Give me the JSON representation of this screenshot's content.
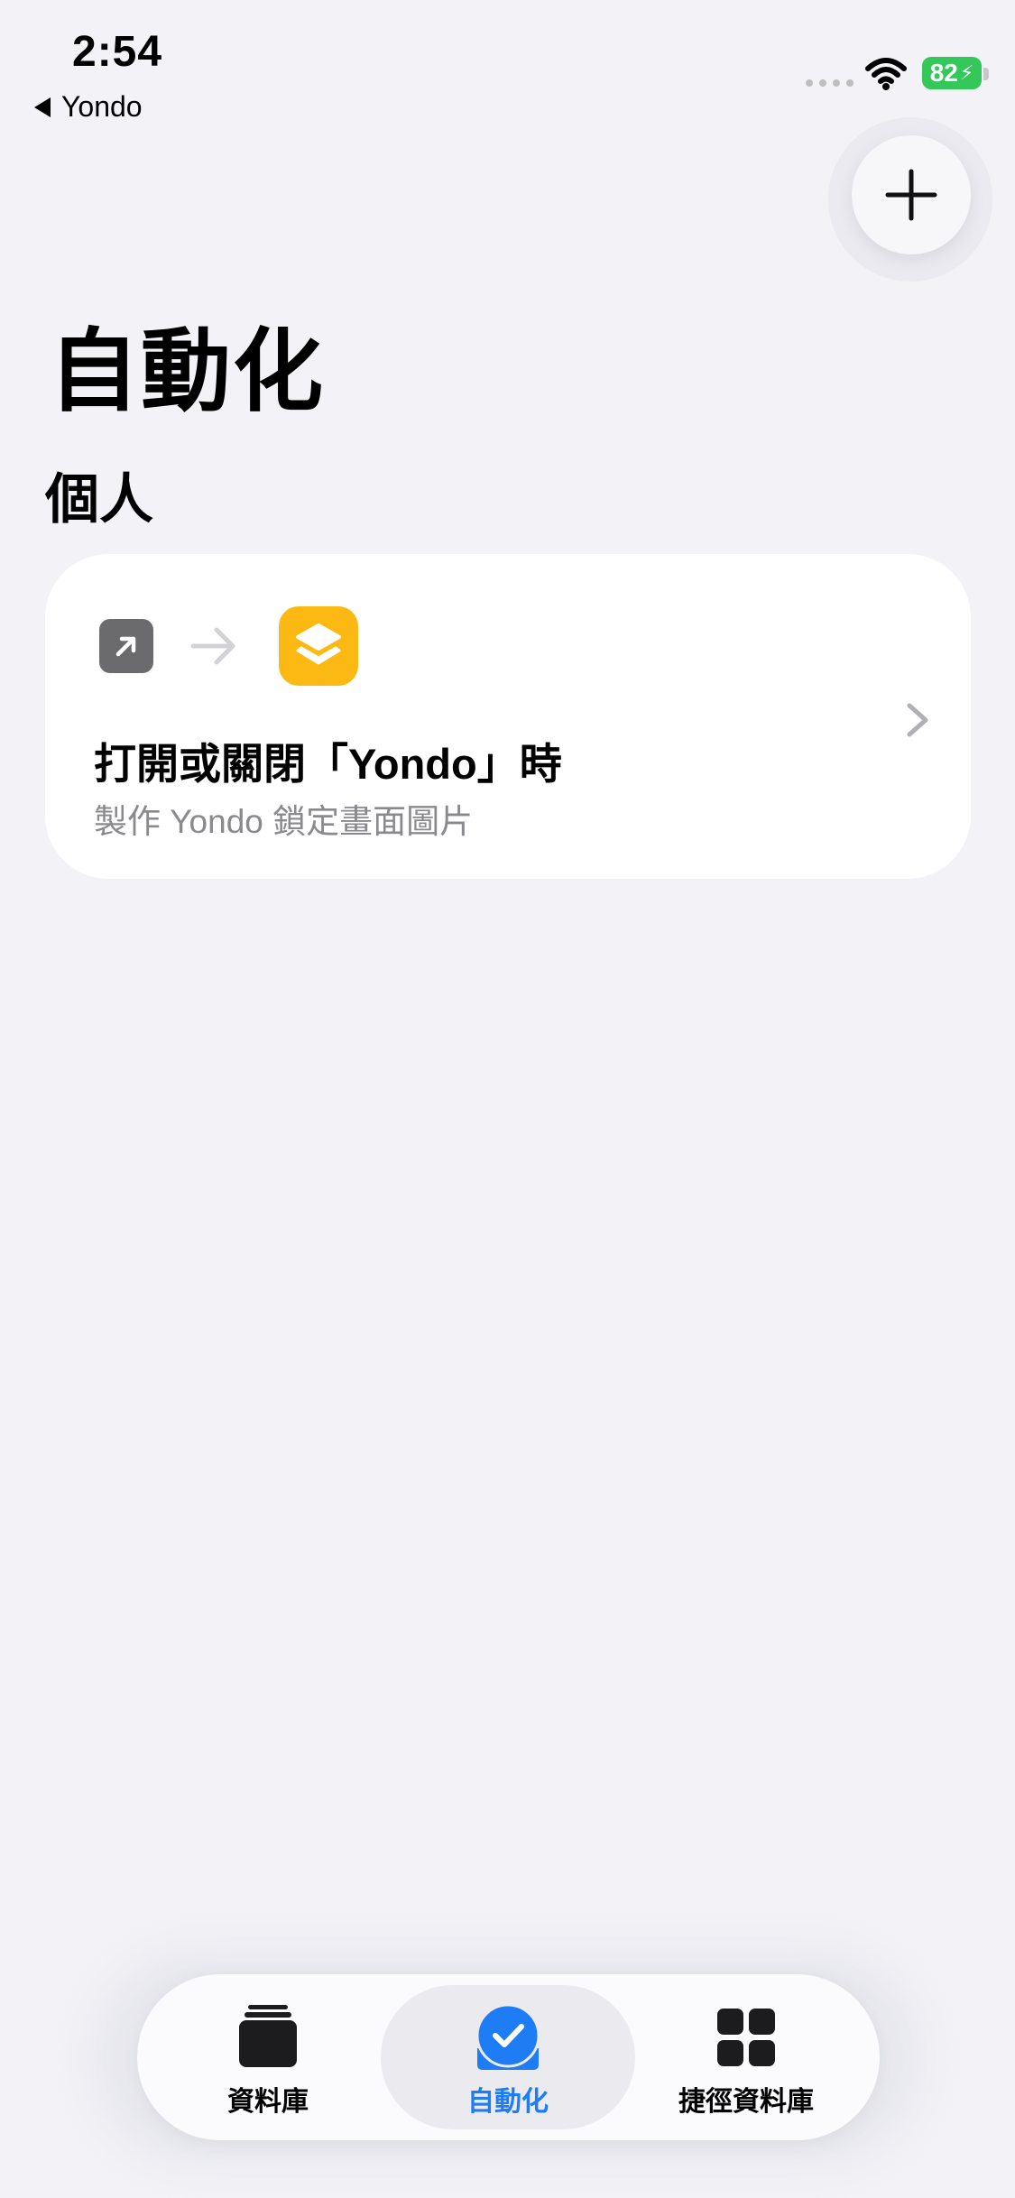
{
  "status_bar": {
    "time": "2:54",
    "back_app": "Yondo",
    "battery": "82"
  },
  "toolbar": {
    "add_icon": "plus-icon"
  },
  "page": {
    "title": "自動化",
    "section_header": "個人"
  },
  "automation_card": {
    "trigger_icon": "app-open-arrow-icon",
    "flow_icon": "right-arrow-icon",
    "app_icon": "yondo-layers-icon",
    "title": "打開或關閉「Yondo」時",
    "subtitle": "製作 Yondo 鎖定畫面圖片",
    "accent_color": "#FDB913"
  },
  "tab_bar": {
    "tabs": [
      {
        "label": "資料庫",
        "icon": "library-stack-icon",
        "selected": false
      },
      {
        "label": "自動化",
        "icon": "automation-check-icon",
        "selected": true
      },
      {
        "label": "捷徑資料庫",
        "icon": "gallery-grid-icon",
        "selected": false
      }
    ],
    "selected_color": "#1E7CF5"
  }
}
